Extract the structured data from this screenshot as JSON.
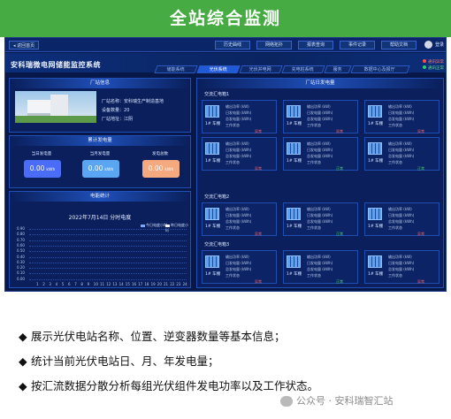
{
  "banner_title": "全站综合监测",
  "topbar": {
    "home": "◂ 返回首页",
    "buttons": [
      "历史曲线",
      "网络拓扑",
      "报表查询",
      "事件记录",
      "帮助文档"
    ],
    "user": "登录"
  },
  "system_title": "安科瑞微电网储能监控系统",
  "nav_tabs": [
    "储能系统",
    "光伏系统",
    "光伏并电网",
    "充电桩系统",
    "服务",
    "数据中心及报厅"
  ],
  "status_legend": {
    "comm_fault": "通讯异常",
    "normal": "通讯正常"
  },
  "station_info": {
    "header": "厂站信息",
    "name_label": "厂站名称：",
    "name_value": "安科瑞生产制造基地",
    "device_count_label": "设备数量：",
    "device_count_value": "20",
    "address_label": "厂站地址：",
    "address_value": "江阴"
  },
  "energy": {
    "header": "累计发电量",
    "items": [
      {
        "label": "当日发电量",
        "value": "0.00",
        "unit": "kWh"
      },
      {
        "label": "当月发电量",
        "value": "0.00",
        "unit": "kWh"
      },
      {
        "label": "发电总数",
        "value": "0.00",
        "unit": "kWh"
      }
    ]
  },
  "chart_data": {
    "type": "line",
    "header": "电能统计",
    "title": "2022年7月14日  分时电度",
    "series": [
      {
        "name": "今日电度小时",
        "values": []
      },
      {
        "name": "昨日电度小时",
        "values": []
      }
    ],
    "yticks": [
      "0.90",
      "0.80",
      "0.70",
      "0.60",
      "0.50",
      "0.40",
      "0.30",
      "0.20",
      "0.10",
      "0.00"
    ],
    "categories": [
      "1",
      "2",
      "3",
      "4",
      "5",
      "6",
      "7",
      "8",
      "9",
      "10",
      "11",
      "12",
      "13",
      "14",
      "15",
      "16",
      "17",
      "18",
      "19",
      "20",
      "21",
      "22",
      "23",
      "24"
    ],
    "ylim": [
      0,
      0.9
    ]
  },
  "inverter_panel": {
    "header": "厂站日发电量",
    "fields": [
      "输出功率 (kW)",
      "日发电量 (kWh)",
      "总发电量 (kWh)",
      "工作状态"
    ],
    "groups": [
      {
        "label": "交流汇电箱1",
        "cards": [
          {
            "name": "1# 车棚",
            "status": "异常"
          },
          {
            "name": "1# 车棚",
            "status": "异常"
          },
          {
            "name": "1# 车棚",
            "status": "异常"
          },
          {
            "name": "1# 车棚",
            "status": "异常"
          },
          {
            "name": "1# 车棚",
            "status": "正常"
          },
          {
            "name": "1# 车棚",
            "status": "正常"
          }
        ]
      },
      {
        "label": "交流汇电箱2",
        "cards": [
          {
            "name": "1# 车棚",
            "status": "异常"
          },
          {
            "name": "1# 车棚",
            "status": "正常"
          },
          {
            "name": "1# 车棚",
            "status": "异常"
          }
        ]
      },
      {
        "label": "交流汇电箱3",
        "cards": [
          {
            "name": "1# 车棚",
            "status": "异常"
          },
          {
            "name": "1# 车棚",
            "status": "正常"
          },
          {
            "name": "1# 车棚",
            "status": "异常"
          }
        ]
      }
    ]
  },
  "bullets": [
    "展示光伏电站名称、位置、逆变器数量等基本信息；",
    "统计当前光伏电站日、月、年发电量；",
    "按汇流数据分散分析每组光伏组件发电功率以及工作状态。"
  ],
  "bullet_mark": "◆",
  "watermark": "公众号 · 安科瑞智汇站",
  "colors": {
    "banner": "#46ab43",
    "screen_bg": "#071748",
    "stat1": "#4a6cf7",
    "stat2": "#5aa6f2",
    "stat3": "#f4a97e",
    "err": "#ff6666",
    "ok": "#52d36b"
  }
}
